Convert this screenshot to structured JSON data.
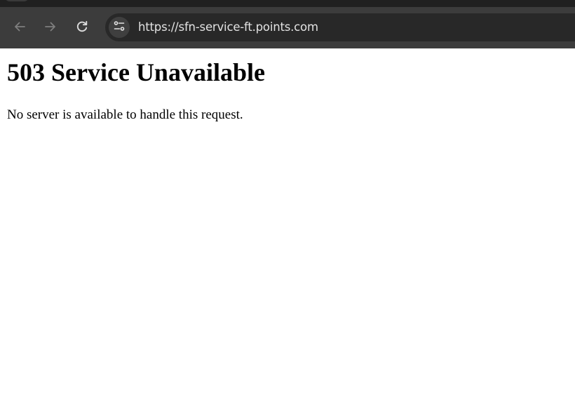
{
  "browser": {
    "url": "https://sfn-service-ft.points.com",
    "icons": {
      "back": "arrow-left-icon",
      "forward": "arrow-right-icon",
      "reload": "reload-icon",
      "site_info": "tune-icon"
    },
    "colors": {
      "toolbar": "#3c3c3c",
      "omnibox": "#282828",
      "url_text": "#e3e3e3"
    }
  },
  "page": {
    "heading": "503 Service Unavailable",
    "message": "No server is available to handle this request."
  }
}
